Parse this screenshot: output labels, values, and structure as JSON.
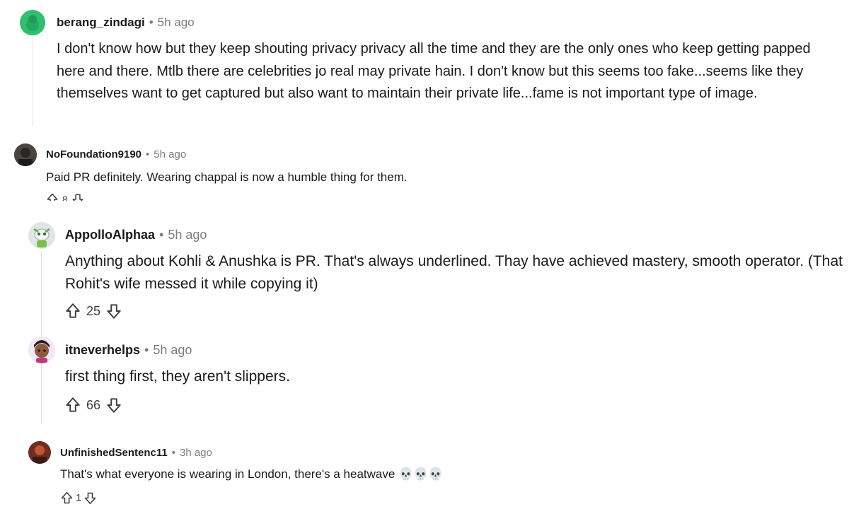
{
  "comments": [
    {
      "author": "berang_zindagi",
      "time": "5h ago",
      "text": "I don't know how but they keep shouting privacy privacy all the time and they are the only ones who keep getting papped here and there. Mtlb there are celebrities jo real may private hain. I don't know but this seems too fake...seems like they themselves want to get captured but also want to maintain their private life...fame is not important type of image."
    },
    {
      "author": "NoFoundation9190",
      "time": "5h ago",
      "text": "Paid PR definitely. Wearing chappal is now a humble thing for them.",
      "votes": "8"
    },
    {
      "author": "AppolloAlphaa",
      "time": "5h ago",
      "text": "Anything about Kohli & Anushka is PR. That's always underlined. Thay have achieved mastery, smooth operator. (That Rohit's wife messed it while copying it)",
      "votes": "25"
    },
    {
      "author": "itneverhelps",
      "time": "5h ago",
      "text": "first thing first, they aren't slippers.",
      "votes": "66"
    },
    {
      "author": "UnfinishedSentenc11",
      "time": "3h ago",
      "text": "That's what everyone is wearing in London, there's a heatwave 💀💀💀",
      "votes": "1"
    }
  ],
  "icons": {
    "upvote": "arrow-up-outline",
    "downvote": "arrow-down-outline",
    "separator": "•"
  }
}
